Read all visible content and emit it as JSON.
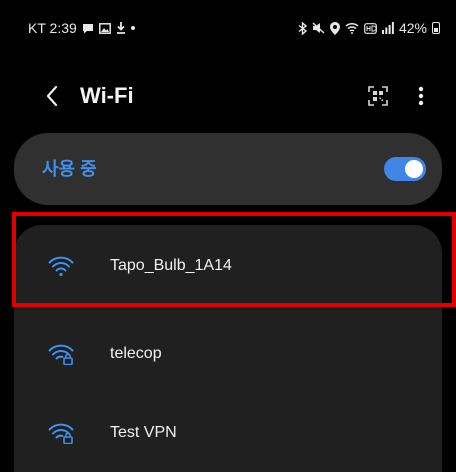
{
  "status_bar": {
    "time": "KT 2:39",
    "battery_percent": "42%",
    "icons_left": [
      "chat-bubble-icon",
      "gallery-icon",
      "download-icon",
      "dot-icon"
    ],
    "icons_right": [
      "bluetooth-icon",
      "mute-icon",
      "location-icon",
      "wifi-icon",
      "hd-voice-icon",
      "signal-icon",
      "battery-icon"
    ]
  },
  "header": {
    "title": "Wi-Fi",
    "back_icon": "chevron-left-icon",
    "qr_icon": "qr-code-icon",
    "more_icon": "more-vertical-icon"
  },
  "wifi_toggle": {
    "label": "사용 중",
    "state": "on",
    "accent_color": "#3f86e7"
  },
  "networks": [
    {
      "name": "Tapo_Bulb_1A14",
      "icon": "wifi-connected-icon",
      "secured": false,
      "highlighted": true
    },
    {
      "name": "telecop",
      "icon": "wifi-locked-icon",
      "secured": true,
      "highlighted": false
    },
    {
      "name": "Test VPN",
      "icon": "wifi-locked-icon",
      "secured": true,
      "highlighted": false
    }
  ],
  "colors": {
    "background": "#000000",
    "card": "#202020",
    "toggle_card": "#303030",
    "accent": "#3e91f0",
    "highlight_box": "#e00000"
  }
}
